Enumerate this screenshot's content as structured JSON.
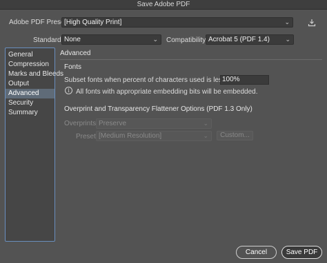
{
  "window": {
    "title": "Save Adobe PDF"
  },
  "preset": {
    "label": "Adobe PDF Preset:",
    "value": "[High Quality Print]"
  },
  "standard": {
    "label": "Standard:",
    "value": "None"
  },
  "compatibility": {
    "label": "Compatibility:",
    "value": "Acrobat 5 (PDF 1.4)"
  },
  "sidebar": {
    "items": [
      {
        "label": "General"
      },
      {
        "label": "Compression"
      },
      {
        "label": "Marks and Bleeds"
      },
      {
        "label": "Output"
      },
      {
        "label": "Advanced"
      },
      {
        "label": "Security"
      },
      {
        "label": "Summary"
      }
    ],
    "selected": "Advanced"
  },
  "panel": {
    "title": "Advanced",
    "fonts": {
      "heading": "Fonts",
      "subset_label": "Subset fonts when percent of characters used is less than:",
      "subset_value": "100%",
      "info_text": "All fonts with appropriate embedding bits will be embedded."
    },
    "overprint": {
      "heading": "Overprint and Transparency Flattener Options (PDF 1.3 Only)",
      "overprints_label": "Overprints:",
      "overprints_value": "Preserve",
      "preset_label": "Preset:",
      "preset_value": "[Medium Resolution]",
      "custom_label": "Custom..."
    }
  },
  "buttons": {
    "cancel": "Cancel",
    "save": "Save PDF"
  }
}
